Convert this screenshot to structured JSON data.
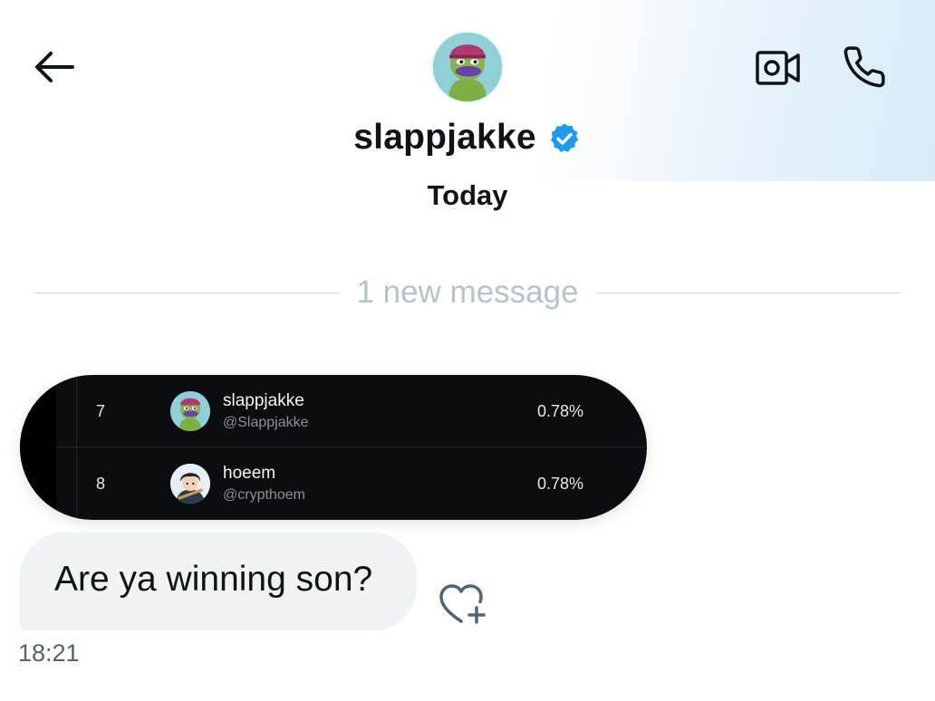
{
  "conversation": {
    "contact_name": "slappjakke",
    "date_label": "Today",
    "new_message_label": "1 new message"
  },
  "header": {
    "back_icon": "arrow-left-icon",
    "video_icon": "video-camera-icon",
    "call_icon": "phone-icon",
    "verified_icon": "verified-badge-icon",
    "verified_color": "#1d9bf0"
  },
  "leaderboard": {
    "rows": [
      {
        "rank": "7",
        "name": "slappjakke",
        "handle": "@Slappjakke",
        "percent": "0.78%"
      },
      {
        "rank": "8",
        "name": "hoeem",
        "handle": "@crypthoem",
        "percent": "0.78%"
      }
    ]
  },
  "message": {
    "text": "Are ya winning son?",
    "time": "18:21",
    "react_icon": "heart-plus-icon"
  },
  "colors": {
    "text_primary": "#0f1419",
    "text_secondary": "#536471",
    "bubble_bg": "#eff3f4",
    "image_bg": "#0c0d10"
  }
}
